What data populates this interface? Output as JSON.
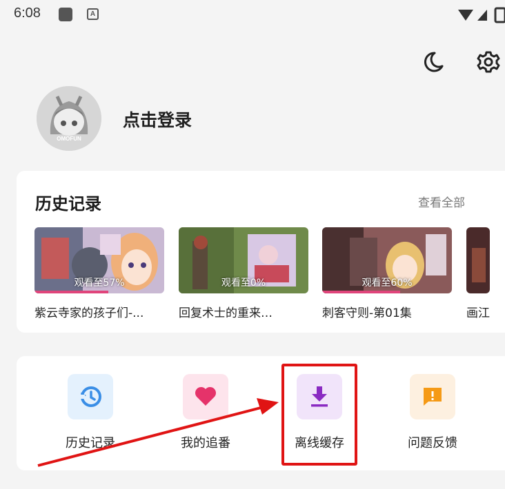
{
  "status_bar": {
    "time": "6:08",
    "notification_letter": "A"
  },
  "header": {
    "theme_icon": "moon-icon",
    "settings_icon": "gear-icon"
  },
  "profile": {
    "login_text": "点击登录",
    "avatar_caption": "OMOFUN"
  },
  "history": {
    "title": "历史记录",
    "view_all": "查看全部",
    "items": [
      {
        "title": "紫云寺家的孩子们-...",
        "progress_text": "观看至57%",
        "progress": 0.57
      },
      {
        "title": "回复术士的重来…",
        "progress_text": "观看至0%",
        "progress": 0.0
      },
      {
        "title": "刺客守则-第01集",
        "progress_text": "观看至60%",
        "progress": 0.6
      },
      {
        "title": "画江",
        "progress_text": "",
        "progress": 0.0
      }
    ]
  },
  "functions": [
    {
      "label": "历史记录",
      "icon": "history-icon",
      "color": "#3a8ee6",
      "bg": "#e4f1fd"
    },
    {
      "label": "我的追番",
      "icon": "heart-icon",
      "color": "#e5336a",
      "bg": "#fde4ec"
    },
    {
      "label": "离线缓存",
      "icon": "download-icon",
      "color": "#8a2bc2",
      "bg": "#f1e4fa"
    },
    {
      "label": "问题反馈",
      "icon": "feedback-icon",
      "color": "#f59a16",
      "bg": "#fdf0e0"
    }
  ],
  "colors": {
    "accent_pink": "#e0457b",
    "highlight_red": "#e01414"
  }
}
